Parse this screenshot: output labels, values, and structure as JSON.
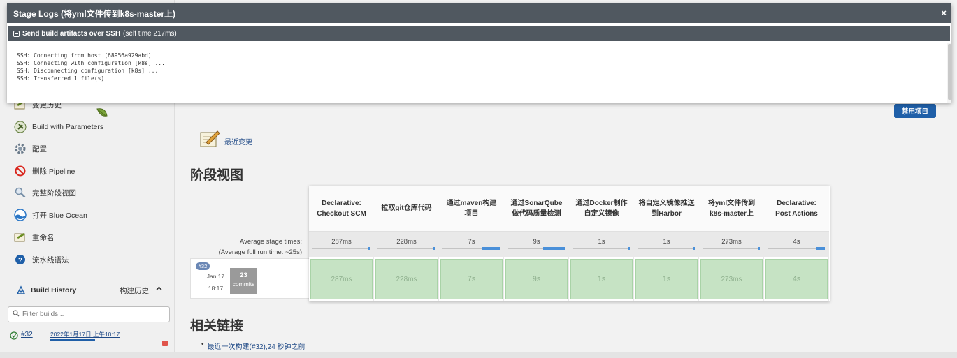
{
  "modal": {
    "title": "Stage Logs (将yml文件传到k8s-master上)",
    "close": "×",
    "step_name": "Send build artifacts over SSH",
    "step_time": "(self time 217ms)",
    "log": "SSH: Connecting from host [68956a929abd]\nSSH: Connecting with configuration [k8s] ...\nSSH: Disconnecting configuration [k8s] ...\nSSH: Transferred 1 file(s)"
  },
  "sidebar": {
    "tasks": [
      {
        "label": "变更历史",
        "icon": "notepad-icon"
      },
      {
        "label": "Build with Parameters",
        "icon": "build-params-icon"
      },
      {
        "label": "配置",
        "icon": "gear-icon"
      },
      {
        "label": "删除 Pipeline",
        "icon": "no-entry-icon"
      },
      {
        "label": "完整阶段视图",
        "icon": "magnifier-icon"
      },
      {
        "label": "打开 Blue Ocean",
        "icon": "blue-ocean-icon"
      },
      {
        "label": "重命名",
        "icon": "notepad-icon"
      },
      {
        "label": "流水线语法",
        "icon": "help-icon"
      }
    ],
    "build_history": {
      "title": "Build History",
      "title_cn": "构建历史",
      "filter_placeholder": "Filter builds...",
      "builds": [
        {
          "number": "#32",
          "time": "2022年1月17日 上午10:17",
          "status": "success"
        }
      ]
    }
  },
  "main": {
    "disable_button": "禁用项目",
    "recent_changes": "最近变更",
    "stage_view_title": "阶段视图",
    "average_label": "Average stage times:",
    "average_full_prefix": "(Average ",
    "average_full_link": "full",
    "average_full_suffix": " run time: ~25s)",
    "stages": [
      {
        "name": "Declarative: Checkout SCM",
        "avg": "287ms",
        "bar_pct": 2,
        "cell": "287ms"
      },
      {
        "name": "拉取git仓库代码",
        "avg": "228ms",
        "bar_pct": 2,
        "cell": "228ms"
      },
      {
        "name": "通过maven构建项目",
        "avg": "7s",
        "bar_pct": 30,
        "cell": "7s"
      },
      {
        "name": "通过SonarQube做代码质量检测",
        "avg": "9s",
        "bar_pct": 38,
        "cell": "9s"
      },
      {
        "name": "通过Docker制作自定义镜像",
        "avg": "1s",
        "bar_pct": 4,
        "cell": "1s"
      },
      {
        "name": "将自定义镜像推送到Harbor",
        "avg": "1s",
        "bar_pct": 4,
        "cell": "1s"
      },
      {
        "name": "将yml文件传到k8s-master上",
        "avg": "273ms",
        "bar_pct": 2,
        "cell": "273ms"
      },
      {
        "name": "Declarative: Post Actions",
        "avg": "4s",
        "bar_pct": 16,
        "cell": "4s"
      }
    ],
    "build": {
      "badge": "#32",
      "date": "Jan 17",
      "time": "18:17",
      "commits_count": "23",
      "commits_label": "commits"
    },
    "related_links_title": "相关链接",
    "last_build_link": "最近一次构建(#32),24 秒钟之前"
  },
  "colors": {
    "modal_bar": "#505860",
    "stage_success": "#c6e3c4",
    "accent": "#1f5fa8"
  }
}
